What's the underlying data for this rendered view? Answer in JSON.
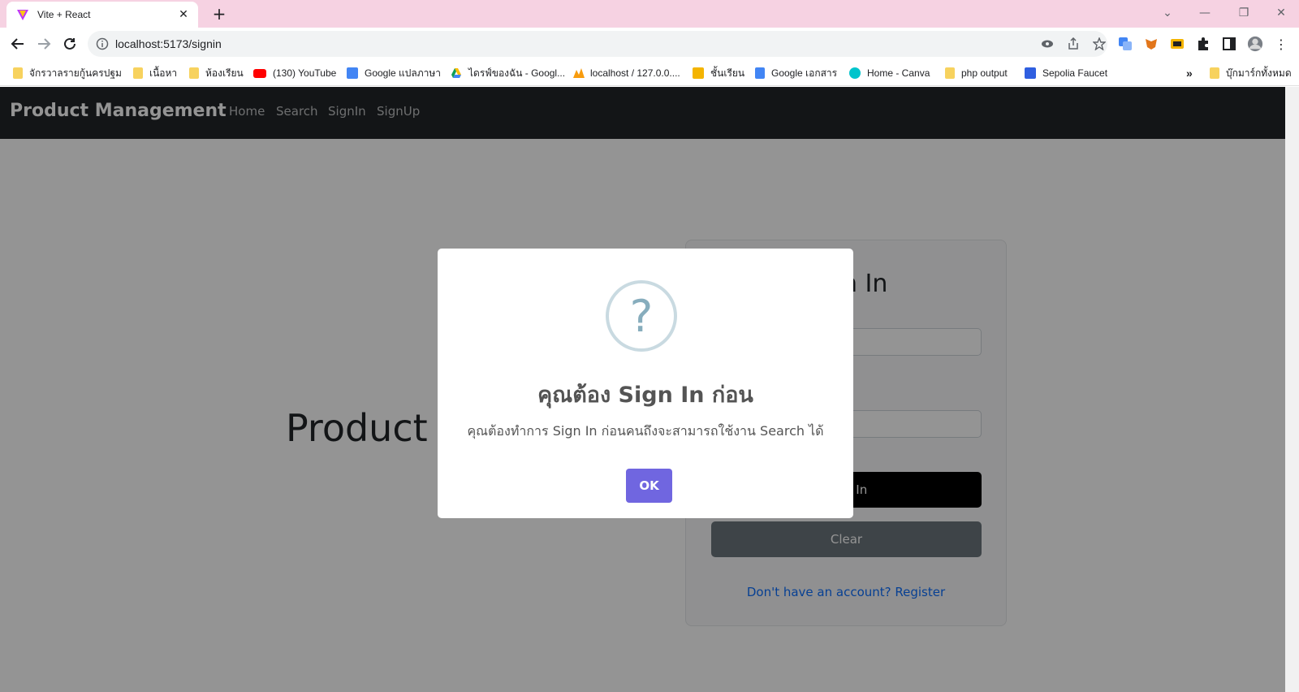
{
  "browser": {
    "tab_title": "Vite + React",
    "url": "localhost:5173/signin",
    "bookmarks": [
      "จักรวาลรายกู้นครปฐม",
      "เนื้อหา",
      "ห้องเรียน",
      "(130) YouTube",
      "Google แปลภาษา",
      "ไดรฟ์ของฉัน - Googl...",
      "localhost / 127.0.0....",
      "ชั้นเรียน",
      "Google เอกสาร",
      "Home - Canva",
      "php output",
      "Sepolia Faucet"
    ],
    "bookmarks_overflow": "»",
    "all_bookmarks": "บุ๊กมาร์กทั้งหมด"
  },
  "navbar": {
    "brand": "Product Management",
    "links": [
      "Home",
      "Search",
      "SignIn",
      "SignUp"
    ]
  },
  "hero": {
    "text": "Product M"
  },
  "signin_card": {
    "title": "Sign In",
    "signin_button": "Sign In",
    "clear_button": "Clear",
    "register_link": "Don't have an account? Register"
  },
  "modal": {
    "icon_symbol": "?",
    "title": "คุณต้อง Sign In ก่อน",
    "text": "คุณต้องทำการ Sign In ก่อนคนถึงจะสามารถใช้งาน Search ได้",
    "ok_button": "OK"
  },
  "colors": {
    "navbar_bg": "#212529",
    "confirm_button": "#7066e0",
    "tabstrip_bg": "#f6d2e2",
    "link": "#0d6efd"
  }
}
